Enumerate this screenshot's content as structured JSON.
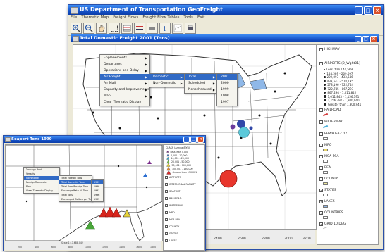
{
  "main_window": {
    "title": "US Department of Transportation GeoFreight",
    "menu": [
      "File",
      "Thematic Map",
      "Freight Flows",
      "Freight Flow Tables",
      "Tools",
      "Exit"
    ],
    "toolbar_icons": [
      "zoom-in-icon",
      "zoom-out-icon",
      "pan-hand-icon",
      "select-icon",
      "table-icon",
      "chart-icon",
      "layer-icon",
      "info-icon",
      "map-icon",
      "print-icon"
    ]
  },
  "map_window": {
    "title": "Total Domestic Freight 2001 (Tons)",
    "coordinate_readout": "46.0000",
    "ruler_ticks": [
      "1800",
      "2000",
      "2200",
      "2400",
      "2600",
      "2800",
      "3000",
      "3200"
    ]
  },
  "context_menu": {
    "level1": [
      "Enplanements",
      "Departures",
      "Operations and Delay",
      "Air Freight",
      "Air Mail",
      "Capacity and Improvements",
      "Map",
      "Clear Thematic Display"
    ],
    "level2": [
      "Domestic",
      "Non-Domestic"
    ],
    "level3": [
      "Total",
      "Scheduled",
      "Nonscheduled"
    ],
    "level4": [
      "2001",
      "2000",
      "1999",
      "1998",
      "1997"
    ]
  },
  "legend": {
    "layers": [
      {
        "label": "HIGHWAY",
        "checked": false
      },
      {
        "label": "AIRPORTS (0_Wght01)",
        "checked": false
      },
      {
        "label": "RAILROAD",
        "checked": false
      },
      {
        "label": "WATERWAY",
        "checked": false
      },
      {
        "label": "FHWA GAZ 07",
        "checked": false
      },
      {
        "label": "MPO",
        "checked": false
      },
      {
        "label": "MSA PSA",
        "checked": false
      },
      {
        "label": "BEA",
        "checked": false
      },
      {
        "label": "COUNTY",
        "checked": false
      },
      {
        "label": "STATES",
        "checked": true
      },
      {
        "label": "LAKES",
        "checked": true
      },
      {
        "label": "COUNTRIES",
        "checked": true
      },
      {
        "label": "GRID 10 DEG",
        "checked": true
      }
    ],
    "airport_bins": [
      "Less than 144,589",
      "144,589 - 209,097",
      "209,097 - 433,646",
      "433,647 - 578,195",
      "578,196 - 722,744",
      "722,745 - 867,293",
      "867,294 - 1,011,842",
      "1,011,843 - 1,156,391",
      "1,156,392 - 1,300,940",
      "Greater than 1,300,941"
    ],
    "bin_colors": [
      "#1a1a1a",
      "#1a1a1a",
      "#1a1a1a",
      "#1a1a1a",
      "#1a1a1a",
      "#1a1a1a",
      "#1a1a1a",
      "#1a1a1a",
      "#1a1a1a",
      "#1a1a1a"
    ],
    "swatch_colors": {
      "RAILROAD": "#d23b3b",
      "WATERWAY": "#4fb0d8",
      "FHWA GAZ 07": "#ffffff",
      "MPO": "#e8d468",
      "MSA PSA": "#ffffff",
      "BEA": "#ffffff",
      "COUNTY": "#f0ec9a",
      "STATES": "#ffffff",
      "LAKES": "#8fb8e8",
      "COUNTRIES": "#ffffff",
      "GRID 10 DEG": "#bbbbbb"
    }
  },
  "second_window": {
    "title": "Seaport Tons 1999",
    "legend_title": "CLASS (Annual/BYR)",
    "legend_bins": [
      "Less than 4,000",
      "4,000 - 10,000",
      "10,001 - 20,000",
      "20,001 - 50,000",
      "50,001 - 100,000",
      "100,001 - 150,000",
      "Greater than 150,001"
    ],
    "legend_colors": [
      "#7a2a8a",
      "#2b6ed1",
      "#3aa9c9",
      "#6ec244",
      "#e8d33a",
      "#e88a2a",
      "#d92b2b"
    ],
    "layers": [
      "AIRPORTS",
      "INTERMODAL FACILITY",
      "SEAPORT",
      "RAILROAD",
      "WATERWAY",
      "MPO",
      "MSA PSA",
      "COUNTY",
      "STATES",
      "LAKES"
    ],
    "menu_level1": [
      "Tonnage Rank",
      "Vessels",
      "Commodity",
      "Foreign/Domestic",
      "Map",
      "Clear Thematic Display"
    ],
    "menu_level2": [
      "Total Foreign Tons",
      "Total Domestic Tons",
      "Total Dom/Foreign Tons",
      "Exchange Rate All Tons",
      "Total Tons",
      "Exchanged Dollars per Ton"
    ],
    "menu_level3": [
      "1999",
      "1998",
      "1997",
      "1996",
      "1995"
    ],
    "ruler_ticks": [
      "200",
      "400",
      "600",
      "800",
      "1000",
      "1200",
      "1400",
      "1600",
      "1800"
    ],
    "scale_label": "Scale 1:17,688,042"
  },
  "colors": {
    "xp_title": "#1553c9",
    "bubble_red": "#e8362c",
    "bubble_blue": "#3148a8",
    "bubble_cyan": "#5cc9da",
    "bubble_purple": "#6a3b9c",
    "triangle_red": "#d8241c",
    "triangle_green": "#49a63a",
    "triangle_yellow": "#e8d33a",
    "triangle_purple": "#7a2a8a"
  }
}
